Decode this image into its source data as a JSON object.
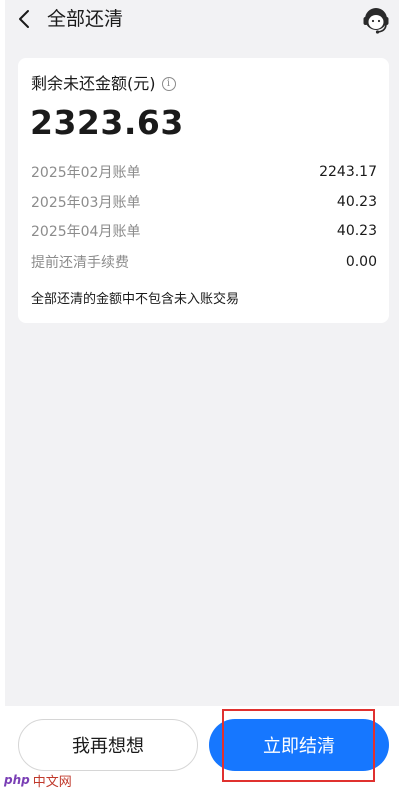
{
  "header": {
    "title": "全部还清",
    "back_icon": "chevron-left-icon",
    "service_icon": "customer-service-icon"
  },
  "card": {
    "label": "剩余未还金额(元)",
    "info_icon": "info-icon",
    "amount": "2323.63",
    "rows": [
      {
        "name": "2025年02月账单",
        "value": "2243.17"
      },
      {
        "name": "2025年03月账单",
        "value": "40.23"
      },
      {
        "name": "2025年04月账单",
        "value": "40.23"
      },
      {
        "name": "提前还清手续费",
        "value": "0.00"
      }
    ],
    "note": "全部还清的金额中不包含未入账交易"
  },
  "footer": {
    "secondary_label": "我再想想",
    "primary_label": "立即结清"
  },
  "watermark": {
    "logo": "php",
    "text": "中文网"
  },
  "colors": {
    "primary": "#1677ff",
    "background": "#f2f2f4",
    "highlight": "#e0312f"
  }
}
